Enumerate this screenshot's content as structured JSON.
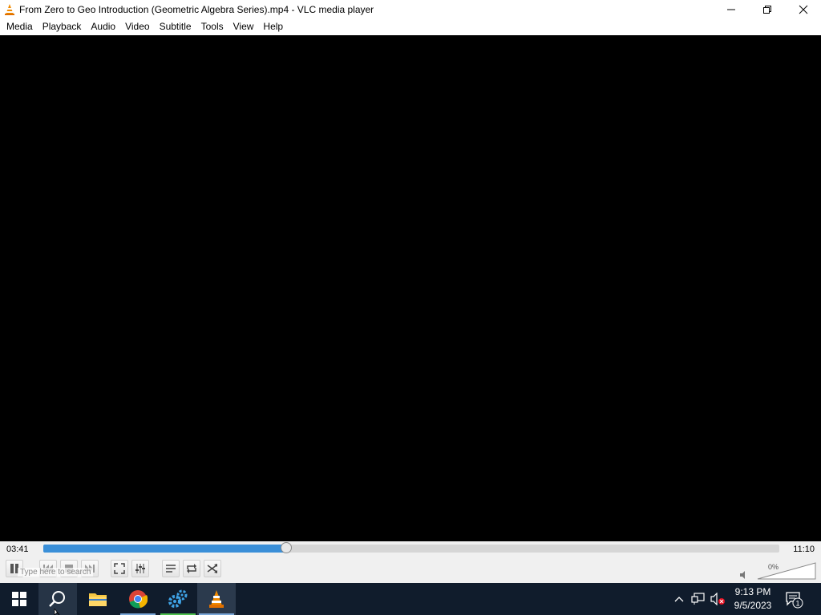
{
  "window": {
    "title": "From Zero to Geo Introduction (Geometric Algebra Series).mp4 - VLC media player",
    "icon": "vlc-cone-icon"
  },
  "menu": [
    {
      "label": "Media"
    },
    {
      "label": "Playback"
    },
    {
      "label": "Audio"
    },
    {
      "label": "Video"
    },
    {
      "label": "Subtitle"
    },
    {
      "label": "Tools"
    },
    {
      "label": "View"
    },
    {
      "label": "Help"
    }
  ],
  "player": {
    "current_time": "03:41",
    "total_time": "11:10",
    "progress_fraction": 0.33,
    "volume_label": "0%",
    "search_hint": "Type here to search"
  },
  "taskbar": {
    "clock_time": "9:13 PM",
    "clock_date": "9/5/2023",
    "notification_count": "1"
  },
  "colors": {
    "accent": "#3a8fd8",
    "taskbar": "#101c2c",
    "video_bg": "#000000"
  }
}
